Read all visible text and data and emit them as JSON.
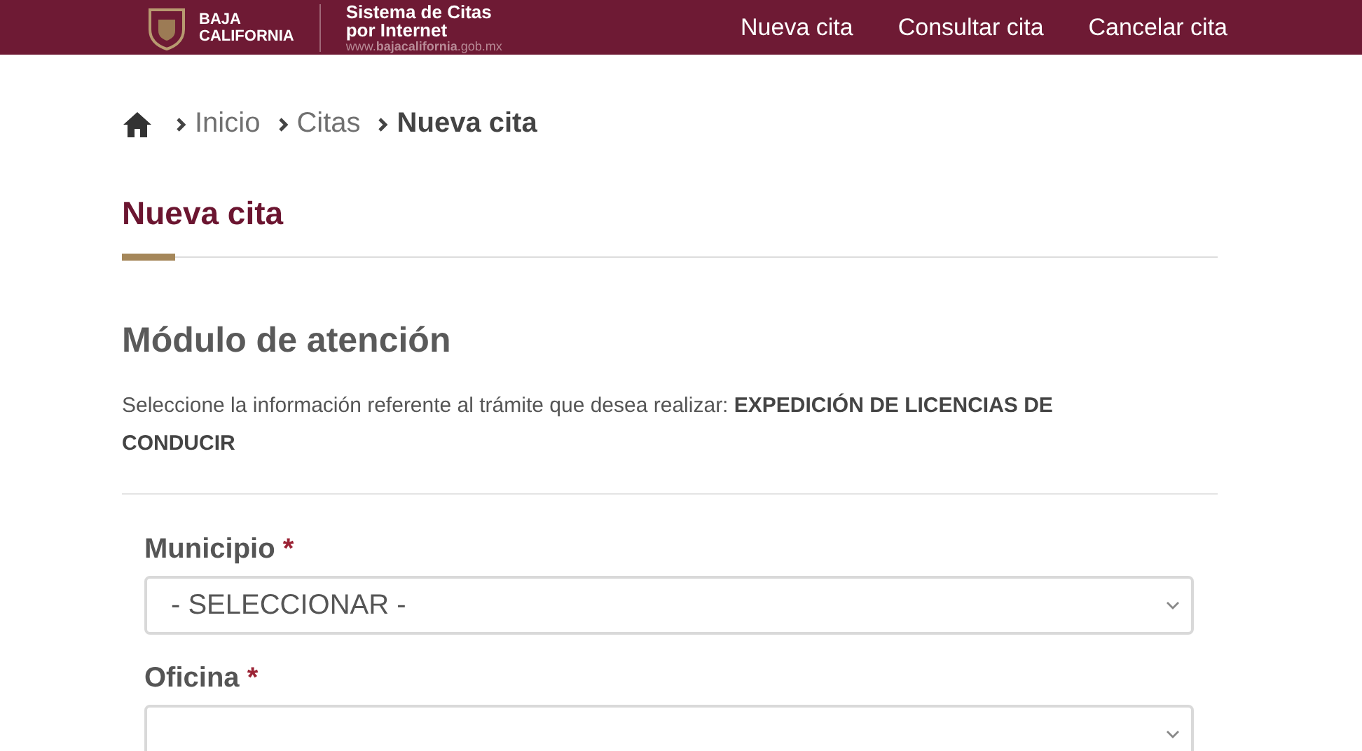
{
  "header": {
    "logo": {
      "line_1": "BAJA",
      "line_2": "CALIFORNIA"
    },
    "system_title": [
      "Sistema de Citas",
      "por Internet"
    ],
    "site_url": {
      "prefix": "www.",
      "bold": "bajacalifornia",
      "suffix": ".gob.mx"
    },
    "nav": [
      "Nueva cita",
      "Consultar cita",
      "Cancelar cita"
    ]
  },
  "breadcrumb": [
    {
      "label": "Inicio",
      "current": false
    },
    {
      "label": "Citas",
      "current": false
    },
    {
      "label": "Nueva cita",
      "current": true
    }
  ],
  "page_title": "Nueva cita",
  "section_title": "Módulo de atención",
  "instructions": "Seleccione la información referente al trámite que desea realizar: **EXPEDICIÓN DE LICENCIAS DE CONDUCIR**",
  "fields": [
    {
      "label": "Municipio",
      "required_mark": "*",
      "value": "- SELECCIONAR -"
    },
    {
      "label": "Oficina",
      "required_mark": "*"
    }
  ]
}
